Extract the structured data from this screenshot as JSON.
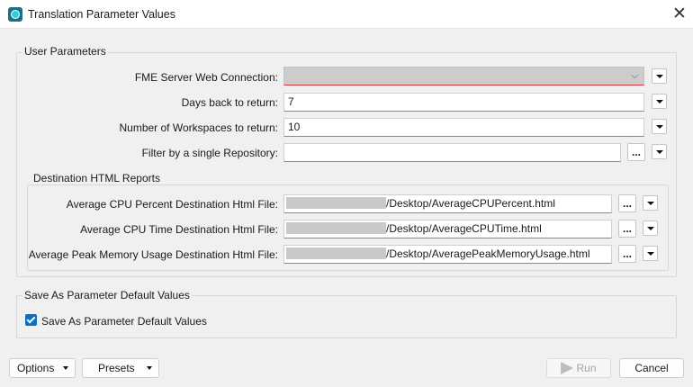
{
  "window": {
    "title": "Translation Parameter Values",
    "close_glyph": "✕"
  },
  "user_params": {
    "title": "User Parameters",
    "fme_server": {
      "label": "FME Server Web Connection:",
      "value": ""
    },
    "days_back": {
      "label": "Days back to return:",
      "value": "7"
    },
    "num_workspaces": {
      "label": "Number of Workspaces to return:",
      "value": "10"
    },
    "repository": {
      "label": "Filter by a single Repository:",
      "value": ""
    }
  },
  "dest_reports": {
    "title": "Destination HTML Reports",
    "cpu_percent": {
      "label": "Average CPU Percent Destination Html File:",
      "value": "/Desktop/AverageCPUPercent.html"
    },
    "cpu_time": {
      "label": "Average CPU Time Destination Html File:",
      "value": "/Desktop/AverageCPUTime.html"
    },
    "peak_memory": {
      "label": "Average Peak Memory Usage Destination Html File:",
      "value": "/Desktop/AveragePeakMemoryUsage.html"
    }
  },
  "save_defaults": {
    "title": "Save As Parameter Default Values",
    "checkbox_label": "Save As Parameter Default Values",
    "checked": true
  },
  "footer": {
    "options_label": "Options",
    "presets_label": "Presets",
    "run_label": "Run",
    "cancel_label": "Cancel"
  },
  "misc": {
    "browse_glyph": "...",
    "chevron_glyph": "⌵"
  },
  "colors": {
    "accent": "#0b6fc7",
    "error_underline": "#d13438",
    "app_icon": "#1b6f8a"
  }
}
